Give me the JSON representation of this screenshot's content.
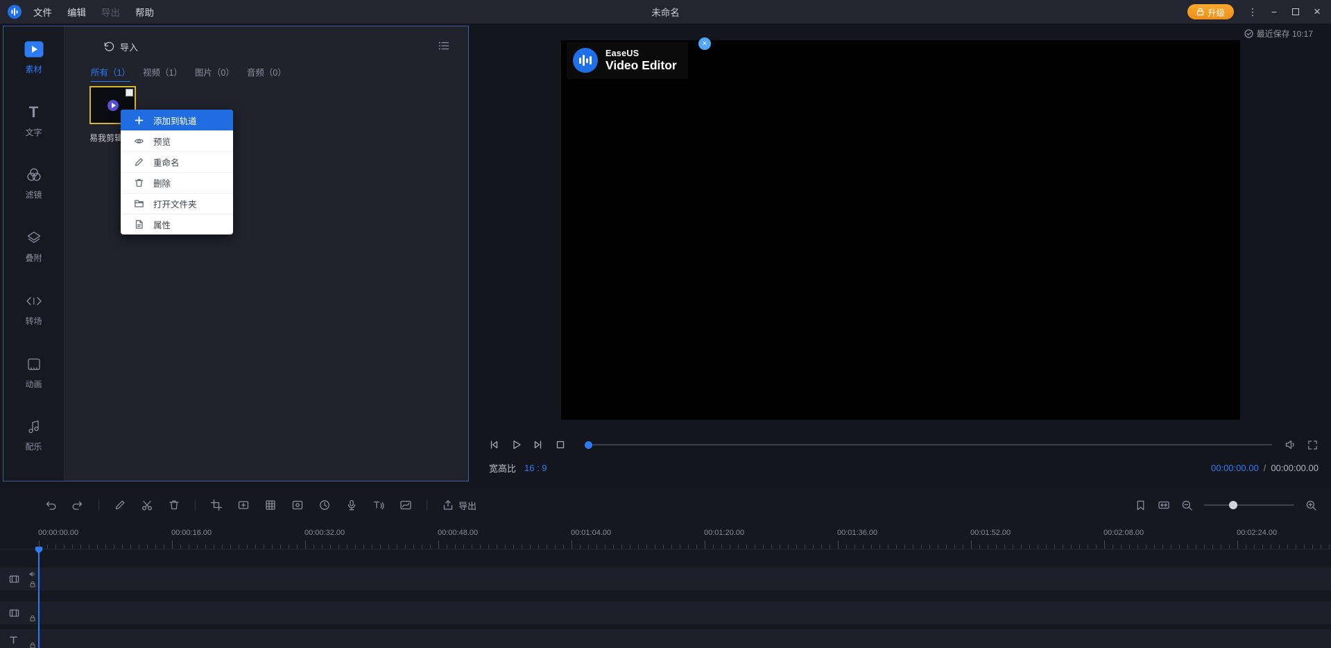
{
  "titlebar": {
    "title": "未命名",
    "menu_file": "文件",
    "menu_edit": "编辑",
    "menu_export": "导出",
    "menu_help": "帮助",
    "upgrade": "升级",
    "more_glyph": "⋮",
    "minimize_glyph": "−",
    "close_glyph": "×"
  },
  "sidebar": {
    "items": [
      {
        "label": "素材",
        "icon": "media-icon",
        "active": true
      },
      {
        "label": "文字",
        "icon": "text-icon"
      },
      {
        "label": "滤镜",
        "icon": "filter-icon"
      },
      {
        "label": "叠附",
        "icon": "overlay-icon"
      },
      {
        "label": "转场",
        "icon": "transition-icon"
      },
      {
        "label": "动画",
        "icon": "animation-icon"
      },
      {
        "label": "配乐",
        "icon": "music-icon"
      }
    ]
  },
  "media": {
    "import": "导入",
    "tabs": [
      {
        "label": "所有（1）",
        "active": true
      },
      {
        "label": "视频（1）"
      },
      {
        "label": "图片（0）"
      },
      {
        "label": "音频（0）"
      }
    ],
    "clip_name": "易我剪辑"
  },
  "context_menu": {
    "items": [
      {
        "label": "添加到轨道",
        "icon": "plus-icon",
        "highlight": true
      },
      {
        "label": "预览",
        "icon": "eye-icon"
      },
      {
        "label": "重命名",
        "icon": "pencil-icon"
      },
      {
        "label": "删除",
        "icon": "trash-icon"
      },
      {
        "label": "打开文件夹",
        "icon": "folder-icon"
      },
      {
        "label": "属性",
        "icon": "properties-icon"
      }
    ]
  },
  "preview": {
    "saved": "最近保存 10:17",
    "brand_name": "EaseUS",
    "brand_product": "Video Editor",
    "close_glyph": "×",
    "aspect_label": "宽高比",
    "aspect_value": "16 : 9",
    "time_current": "00:00:00.00",
    "time_sep": "/",
    "time_total": "00:00:00.00"
  },
  "timeline": {
    "export": "导出",
    "toolbar_icons": [
      "undo",
      "redo",
      "edit",
      "cut",
      "delete",
      "crop",
      "freeze-frame",
      "mosaic",
      "zoom-frame",
      "duration",
      "voiceover",
      "text-to-speech",
      "curve"
    ],
    "right_icons": [
      "marker",
      "fit-width",
      "zoom-out",
      "zoom-slider",
      "zoom-in"
    ],
    "ruler": [
      "00:00:00.00",
      "00:00:16.00",
      "00:00:32.00",
      "00:00:48.00",
      "00:01:04.00",
      "00:01:20.00",
      "00:01:36.00",
      "00:01:52.00",
      "00:02:08.00",
      "00:02:24.00"
    ]
  },
  "colors": {
    "accent": "#2e7bf6",
    "menu_highlight": "#1f6ce0",
    "upgrade_orange": "#f59d26",
    "selection_yellow": "#d9b827",
    "context_menu_bg": "#ffffff"
  }
}
